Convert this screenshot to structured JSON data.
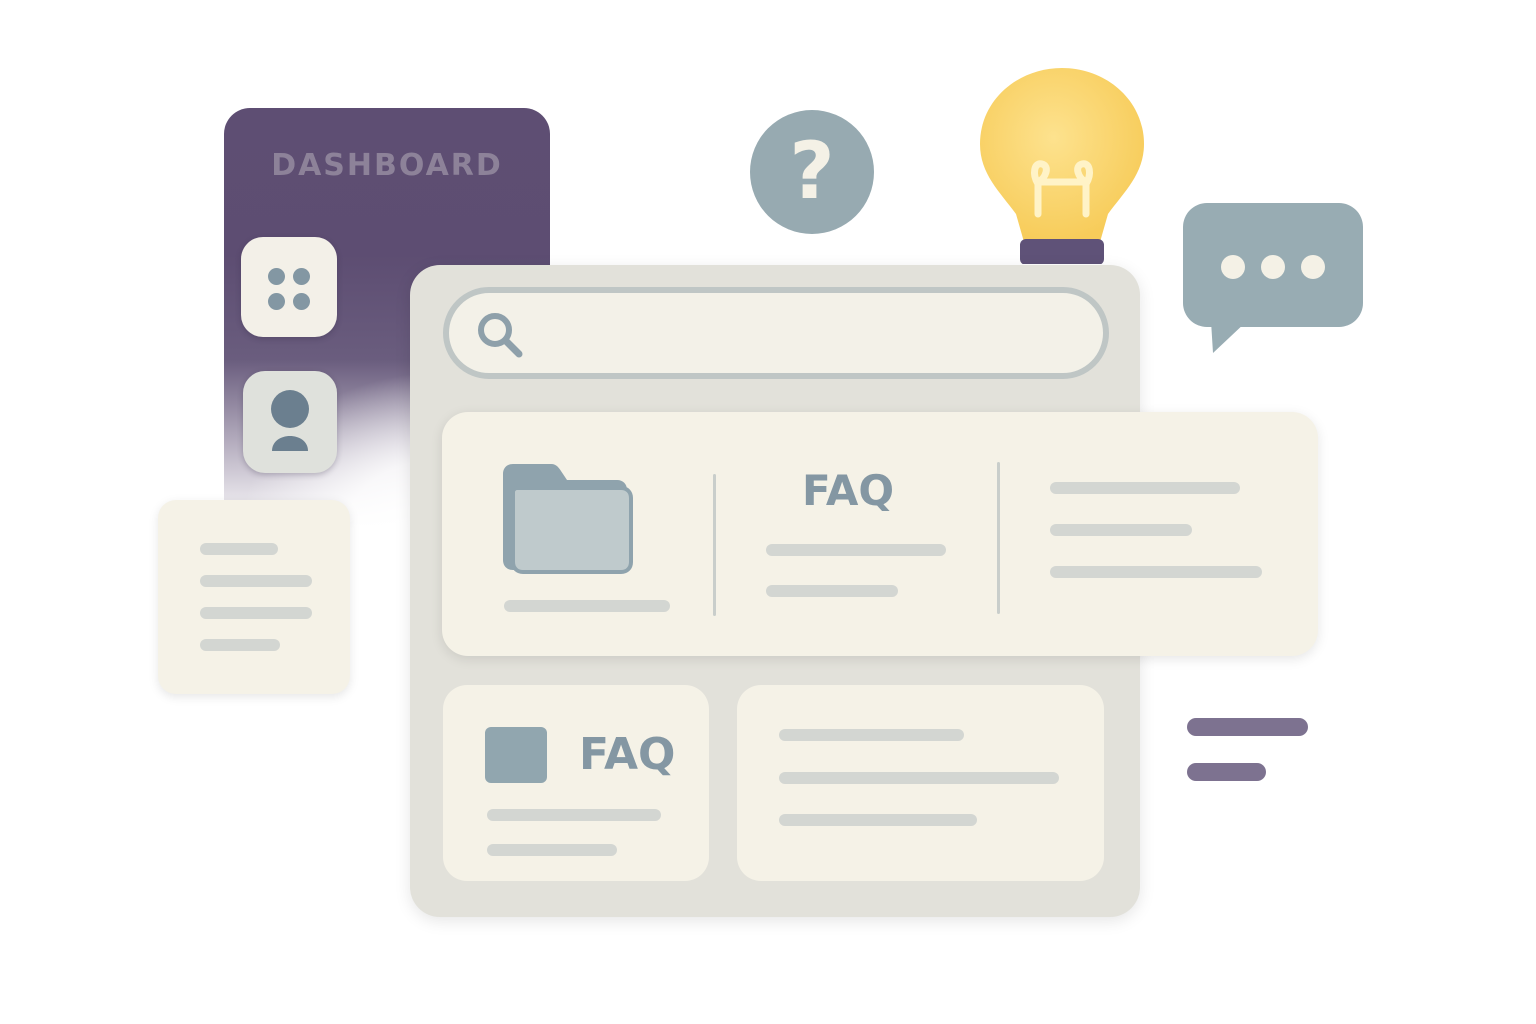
{
  "dashboard": {
    "title": "DASHBOARD"
  },
  "faq_card_top": {
    "label": "FAQ"
  },
  "faq_card_bottom": {
    "label": "FAQ"
  },
  "help_bubble": {
    "symbol": "?"
  },
  "colors": {
    "dashboard_panel": "#5e4e73",
    "card_background": "#f5f2e7",
    "window_background": "#e2e1da",
    "accent_slate": "#8497a3",
    "bulb_yellow": "#fbd56a",
    "lines": "#d3d6d2",
    "side_bars": "#7d7290"
  },
  "icons": [
    "grid-icon",
    "user-icon",
    "search-icon",
    "folder-icon",
    "question-icon",
    "lightbulb-icon",
    "chat-icon",
    "square-icon"
  ]
}
